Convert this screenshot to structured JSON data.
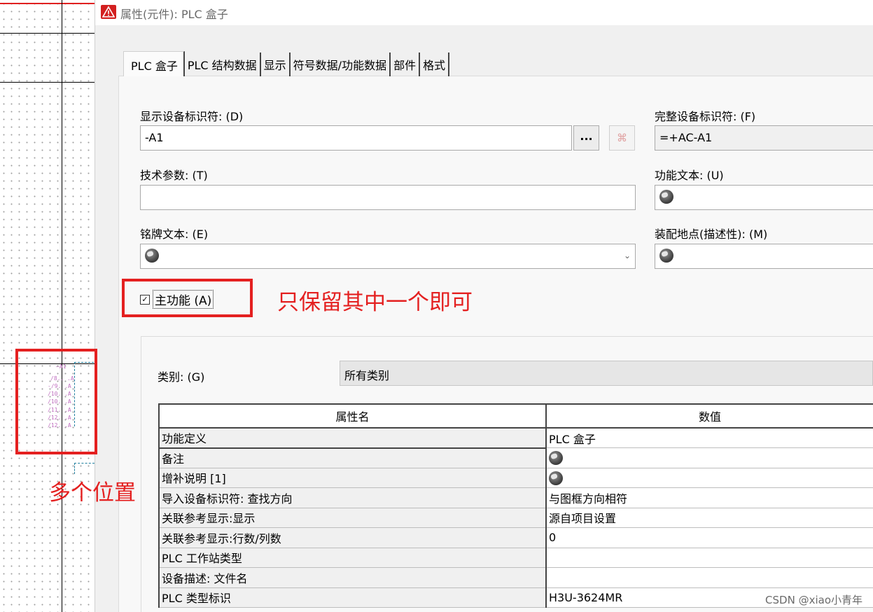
{
  "window": {
    "title": "属性(元件): PLC 盒子"
  },
  "schematic": {
    "symbol_labels": [
      "—A1",
      "/8.. .A",
      "-/9. .A",
      "/10. .A",
      "/10. .A",
      "/11. .A",
      "/12. .A",
      "/12. .A"
    ]
  },
  "tabs": [
    {
      "label": "PLC 盒子",
      "active": true
    },
    {
      "label": "PLC 结构数据",
      "active": false
    },
    {
      "label": "显示",
      "active": false
    },
    {
      "label": "符号数据/功能数据",
      "active": false
    },
    {
      "label": "部件",
      "active": false
    },
    {
      "label": "格式",
      "active": false
    }
  ],
  "form": {
    "display_dt_label": "显示设备标识符: (D)",
    "display_dt_value": "-A1",
    "browse_button_label": "...",
    "clear_button_glyph": "⌘",
    "full_dt_label": "完整设备标识符: (F)",
    "full_dt_value": "=+AC-A1",
    "tech_params_label": "技术参数: (T)",
    "tech_params_value": "",
    "function_text_label": "功能文本: (U)",
    "nameplate_label": "铭牌文本: (E)",
    "mounting_label": "装配地点(描述性): (M)",
    "main_function_label": "主功能 (A)",
    "main_function_checked": true,
    "category_label": "类别: (G)",
    "category_value": "所有类别"
  },
  "annotations": {
    "keep_one": "只保留其中一个即可",
    "multiple_positions": "多个位置"
  },
  "table": {
    "headers": [
      "属性名",
      "数值"
    ],
    "rows": [
      {
        "name": "功能定义",
        "value": "PLC 盒子",
        "globe": false
      },
      {
        "name": "备注",
        "value": "",
        "globe": true
      },
      {
        "name": "增补说明 [1]",
        "value": "",
        "globe": true
      },
      {
        "name": "导入设备标识符: 查找方向",
        "value": "与图框方向相符",
        "globe": false
      },
      {
        "name": "关联参考显示:显示",
        "value": "源自项目设置",
        "globe": false
      },
      {
        "name": "关联参考显示:行数/列数",
        "value": "0",
        "globe": false
      },
      {
        "name": "PLC 工作站类型",
        "value": "",
        "globe": false
      },
      {
        "name": "设备描述: 文件名",
        "value": "",
        "globe": false
      },
      {
        "name": "PLC 类型标识",
        "value": "H3U-3624MR",
        "globe": false
      }
    ]
  },
  "watermark": "CSDN @xiao小青年",
  "colors": {
    "annotation_red": "#e42020",
    "dialog_bg": "#f0f0f0",
    "symbol_pink": "#c070c0",
    "dashed_blue": "#1f7f9f"
  }
}
